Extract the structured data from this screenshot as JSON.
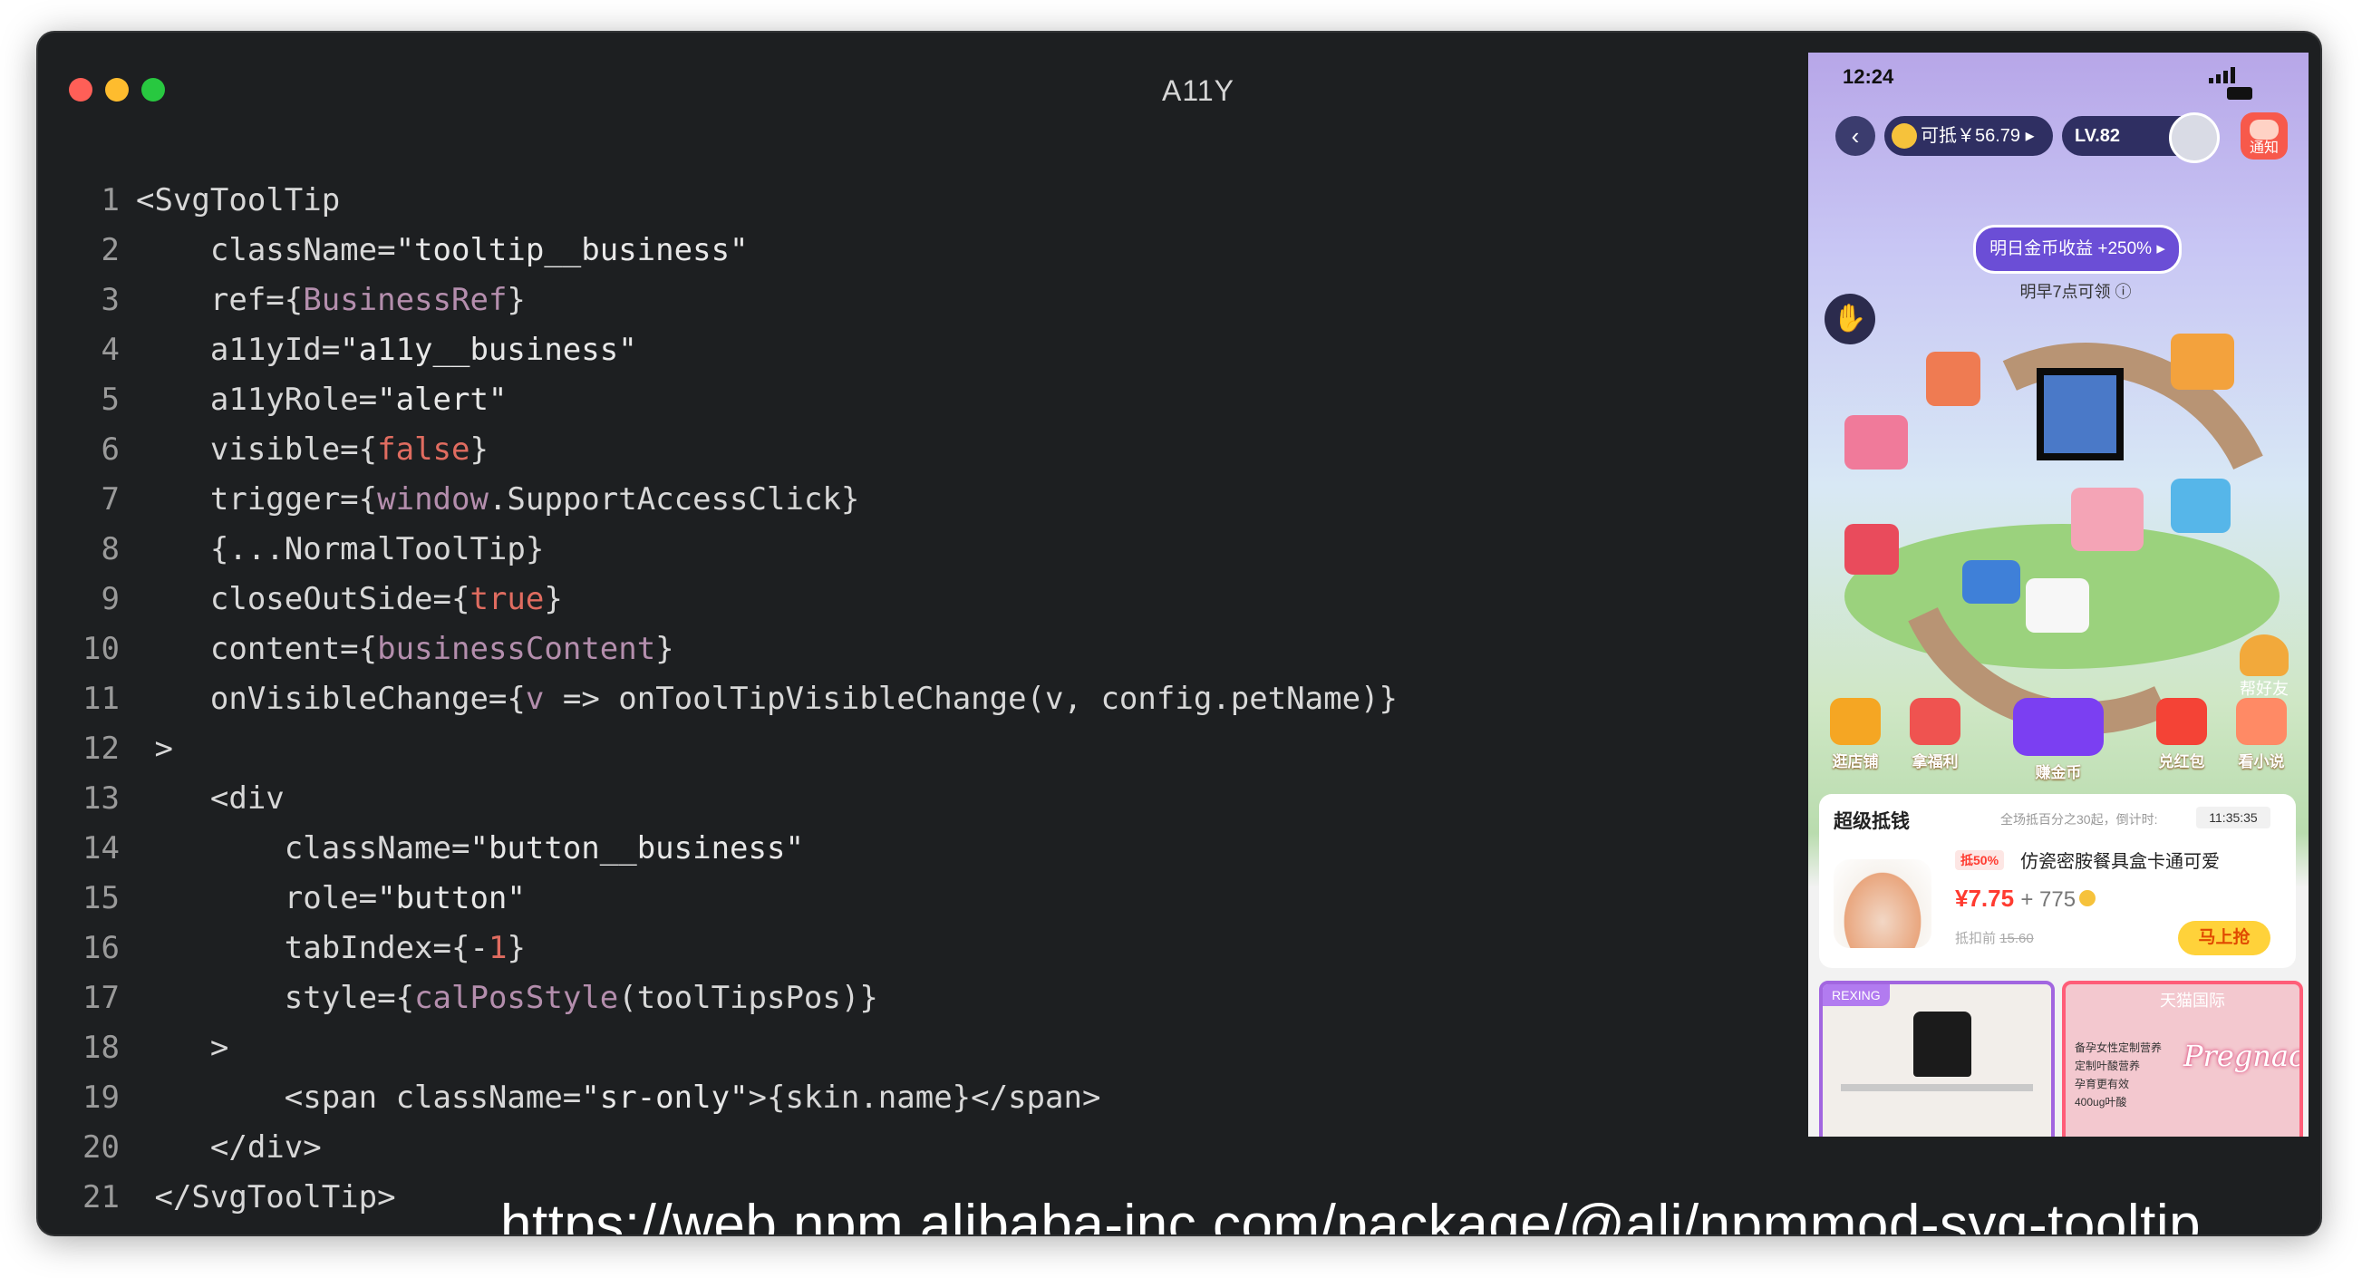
{
  "window": {
    "title": "A11Y"
  },
  "code_lines": [
    {
      "n": "1",
      "tokens": [
        [
          "tag",
          "<SvgToolTip"
        ]
      ]
    },
    {
      "n": "2",
      "tokens": [
        [
          "attr",
          "    className="
        ],
        [
          "str",
          "\"tooltip__business\""
        ]
      ]
    },
    {
      "n": "3",
      "tokens": [
        [
          "attr",
          "    ref="
        ],
        [
          "attr",
          "{"
        ],
        [
          "ref",
          "BusinessRef"
        ],
        [
          "attr",
          "}"
        ]
      ]
    },
    {
      "n": "4",
      "tokens": [
        [
          "attr",
          "    a11yId="
        ],
        [
          "str",
          "\"a11y__business\""
        ]
      ]
    },
    {
      "n": "5",
      "tokens": [
        [
          "attr",
          "    a11yRole="
        ],
        [
          "str",
          "\"alert\""
        ]
      ]
    },
    {
      "n": "6",
      "tokens": [
        [
          "attr",
          "    visible="
        ],
        [
          "attr",
          "{"
        ],
        [
          "kw",
          "false"
        ],
        [
          "attr",
          "}"
        ]
      ]
    },
    {
      "n": "7",
      "tokens": [
        [
          "attr",
          "    trigger="
        ],
        [
          "attr",
          "{"
        ],
        [
          "ref",
          "window"
        ],
        [
          "attr",
          ".SupportAccessClick}"
        ]
      ]
    },
    {
      "n": "8",
      "tokens": [
        [
          "attr",
          "    {...NormalToolTip}"
        ]
      ]
    },
    {
      "n": "9",
      "tokens": [
        [
          "attr",
          "    closeOutSide="
        ],
        [
          "attr",
          "{"
        ],
        [
          "kw",
          "true"
        ],
        [
          "attr",
          "}"
        ]
      ]
    },
    {
      "n": "10",
      "tokens": [
        [
          "attr",
          "    content="
        ],
        [
          "attr",
          "{"
        ],
        [
          "ref",
          "businessContent"
        ],
        [
          "attr",
          "}"
        ]
      ]
    },
    {
      "n": "11",
      "tokens": [
        [
          "attr",
          "    onVisibleChange="
        ],
        [
          "attr",
          "{"
        ],
        [
          "ref",
          "v"
        ],
        [
          "attr",
          " => onToolTipVisibleChange(v, config.petName)}"
        ]
      ]
    },
    {
      "n": "12",
      "tokens": [
        [
          "tag",
          " >"
        ]
      ]
    },
    {
      "n": "13",
      "tokens": [
        [
          "tag",
          "    <div"
        ]
      ]
    },
    {
      "n": "14",
      "tokens": [
        [
          "attr",
          "        className="
        ],
        [
          "str",
          "\"button__business\""
        ]
      ]
    },
    {
      "n": "15",
      "tokens": [
        [
          "attr",
          "        role="
        ],
        [
          "str",
          "\"button\""
        ]
      ]
    },
    {
      "n": "16",
      "tokens": [
        [
          "attr",
          "        tabIndex="
        ],
        [
          "attr",
          "{-"
        ],
        [
          "kw",
          "1"
        ],
        [
          "attr",
          "}"
        ]
      ]
    },
    {
      "n": "17",
      "tokens": [
        [
          "attr",
          "        style="
        ],
        [
          "attr",
          "{"
        ],
        [
          "ref",
          "calPosStyle"
        ],
        [
          "attr",
          "(toolTipsPos)}"
        ]
      ]
    },
    {
      "n": "18",
      "tokens": [
        [
          "tag",
          "    >"
        ]
      ]
    },
    {
      "n": "19",
      "tokens": [
        [
          "tag",
          "        <span className="
        ],
        [
          "str",
          "\"sr-only\""
        ],
        [
          "tag",
          ">{skin.name}</span>"
        ]
      ]
    },
    {
      "n": "20",
      "tokens": [
        [
          "tag",
          "    </div>"
        ]
      ]
    },
    {
      "n": "21",
      "tokens": [
        [
          "tag",
          " </SvgToolTip>"
        ]
      ]
    }
  ],
  "url": "https://web.npm.alibaba-inc.com/package/@ali/npmmod-svg-tooltip",
  "phone": {
    "status_time": "12:24",
    "coin_balance": "可抵￥56.79",
    "level": "LV.82",
    "notice_label": "通知",
    "bonus_label": "明日金币收益 +250%",
    "bonus_sub": "明早7点可领",
    "helper_label": "帮好友",
    "nav": [
      "逛店铺",
      "拿福利",
      "赚金币",
      "兑红包",
      "看小说"
    ],
    "card": {
      "title": "超级抵钱",
      "meta": "全场抵百分之30起，倒计时:",
      "timer": "11:35:35",
      "discount": "抵50%",
      "product_name": "仿瓷密胺餐具盒卡通可爱",
      "price": "¥7.75",
      "price_plus": "+ 775",
      "orig_label": "抵扣前",
      "orig_price": "15.60",
      "buy_label": "马上抢"
    },
    "tile_left_label": "REXING",
    "tile_right_tag": "天猫国际",
    "tile_right_brand": "Pregnacare",
    "tile_right_list": [
      "备孕女性定制营养",
      "定制叶酸营养",
      "孕育更有效",
      "400ug叶酸"
    ]
  },
  "colors": {
    "bg": "#1d1f21",
    "keyword": "#e06c60",
    "reference": "#b48ead"
  }
}
